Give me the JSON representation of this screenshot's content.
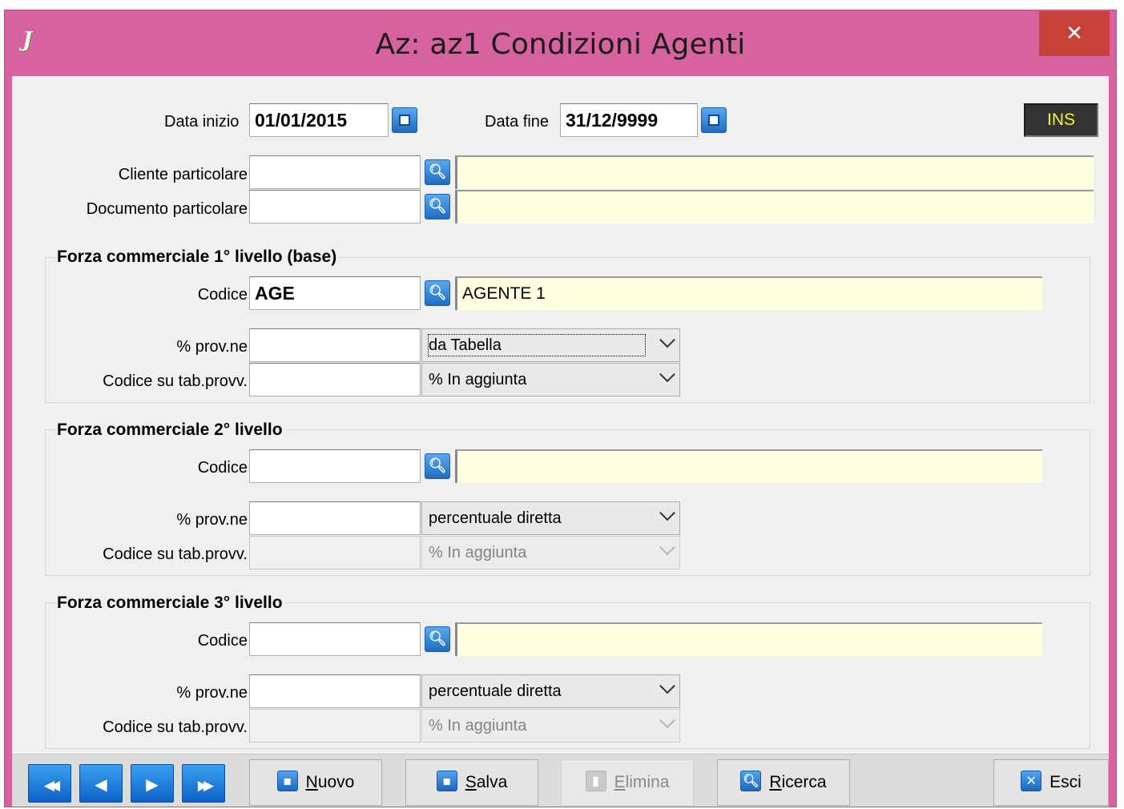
{
  "window": {
    "title": "Az: az1   Condizioni Agenti",
    "close_glyph": "✕",
    "app_icon_glyph": "J"
  },
  "header": {
    "data_inizio_label": "Data inizio",
    "data_inizio_value": "01/01/2015",
    "data_fine_label": "Data fine",
    "data_fine_value": "31/12/9999",
    "mode_badge": "INS",
    "cliente_label": "Cliente particolare",
    "cliente_value": "",
    "cliente_descr": "",
    "documento_label": "Documento particolare",
    "documento_value": "",
    "documento_descr": ""
  },
  "level1": {
    "title": "Forza commerciale 1° livello (base)",
    "codice_label": "Codice",
    "codice_value": "AGE",
    "codice_descr": "AGENTE 1",
    "prov_label": "% prov.ne",
    "prov_value": "",
    "prov_select": "da Tabella",
    "tab_label": "Codice su tab.provv.",
    "tab_value": "",
    "tab_select": "% In aggiunta"
  },
  "level2": {
    "title": "Forza commerciale 2° livello",
    "codice_label": "Codice",
    "codice_value": "",
    "codice_descr": "",
    "prov_label": "% prov.ne",
    "prov_value": "",
    "prov_select": "percentuale diretta",
    "tab_label": "Codice su tab.provv.",
    "tab_value": "",
    "tab_select": "% In aggiunta"
  },
  "level3": {
    "title": "Forza commerciale 3° livello",
    "codice_label": "Codice",
    "codice_value": "",
    "codice_descr": "",
    "prov_label": "% prov.ne",
    "prov_value": "",
    "prov_select": "percentuale diretta",
    "tab_label": "Codice su tab.provv.",
    "tab_value": "",
    "tab_select": "% In aggiunta"
  },
  "toolbar": {
    "first_glyph": "◀◀",
    "prev_glyph": "◀",
    "next_glyph": "▶",
    "last_glyph": "▶▶",
    "nuovo_first": "N",
    "nuovo_rest": "uovo",
    "salva_first": "S",
    "salva_rest": "alva",
    "elimina_first": "E",
    "elimina_rest": "limina",
    "ricerca_first": "R",
    "ricerca_rest": "icerca",
    "esci_label": "Esci"
  },
  "colors": {
    "title_bar": "#d6639f",
    "close_button": "#c7403a",
    "descr_field": "#ffffe1",
    "mode_badge_text": "#f5f52a"
  },
  "icons": [
    "app-logo-icon",
    "close-icon",
    "calendar-icon",
    "search-icon",
    "chevron-down-icon",
    "first-record-icon",
    "previous-record-icon",
    "next-record-icon",
    "last-record-icon",
    "new-icon",
    "save-icon",
    "delete-icon",
    "search-icon",
    "exit-icon"
  ]
}
